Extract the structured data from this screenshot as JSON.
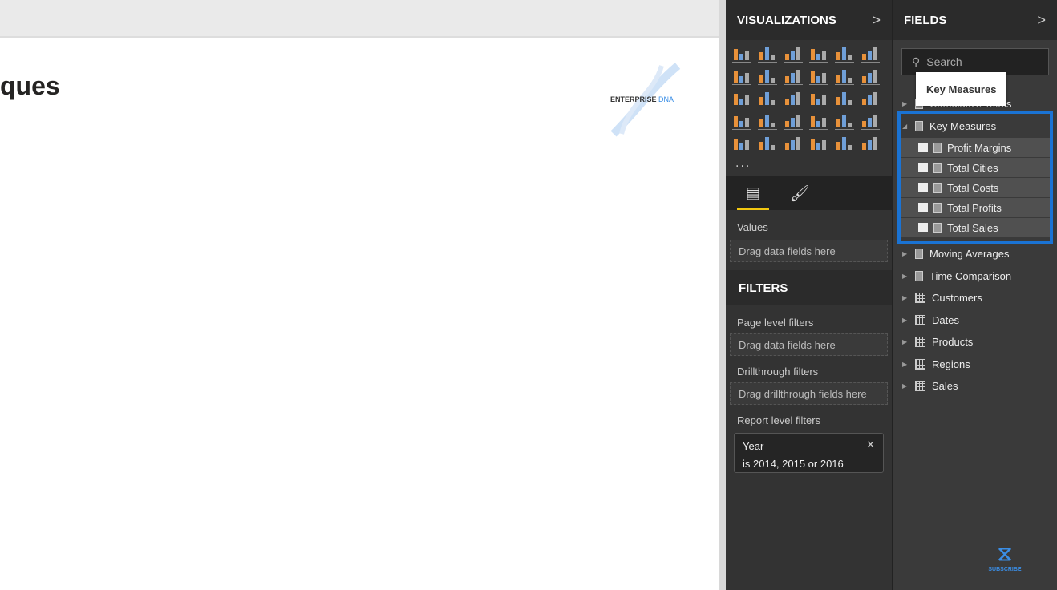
{
  "canvas": {
    "title_fragment": "ques",
    "logo": "ENTERPRISE DNA",
    "logo_parts": [
      "ENTERPRISE",
      "DNA"
    ]
  },
  "visualizations": {
    "title": "VISUALIZATIONS",
    "more": "...",
    "tabs": [
      "fields-tab",
      "format-tab"
    ],
    "values_label": "Values",
    "values_drop": "Drag data fields here"
  },
  "filters": {
    "title": "FILTERS",
    "page_label": "Page level filters",
    "page_drop": "Drag data fields here",
    "drill_label": "Drillthrough filters",
    "drill_drop": "Drag drillthrough fields here",
    "report_label": "Report level filters",
    "card": {
      "field": "Year",
      "condition": "is 2014, 2015 or 2016"
    }
  },
  "fields": {
    "title": "FIELDS",
    "search_placeholder": "Search",
    "tooltip": "Key Measures",
    "covered": "Cumulative Totals",
    "expanded": "Key Measures",
    "measures": [
      "Profit Margins",
      "Total Cities",
      "Total Costs",
      "Total Profits",
      "Total Sales"
    ],
    "calc_tables": [
      "Moving Averages",
      "Time Comparison"
    ],
    "tables": [
      "Customers",
      "Dates",
      "Products",
      "Regions",
      "Sales"
    ]
  },
  "subscribe": "SUBSCRIBE",
  "colors": {
    "accent": "#1a73d4",
    "active_tab": "#f2c811",
    "panel": "#333333"
  }
}
